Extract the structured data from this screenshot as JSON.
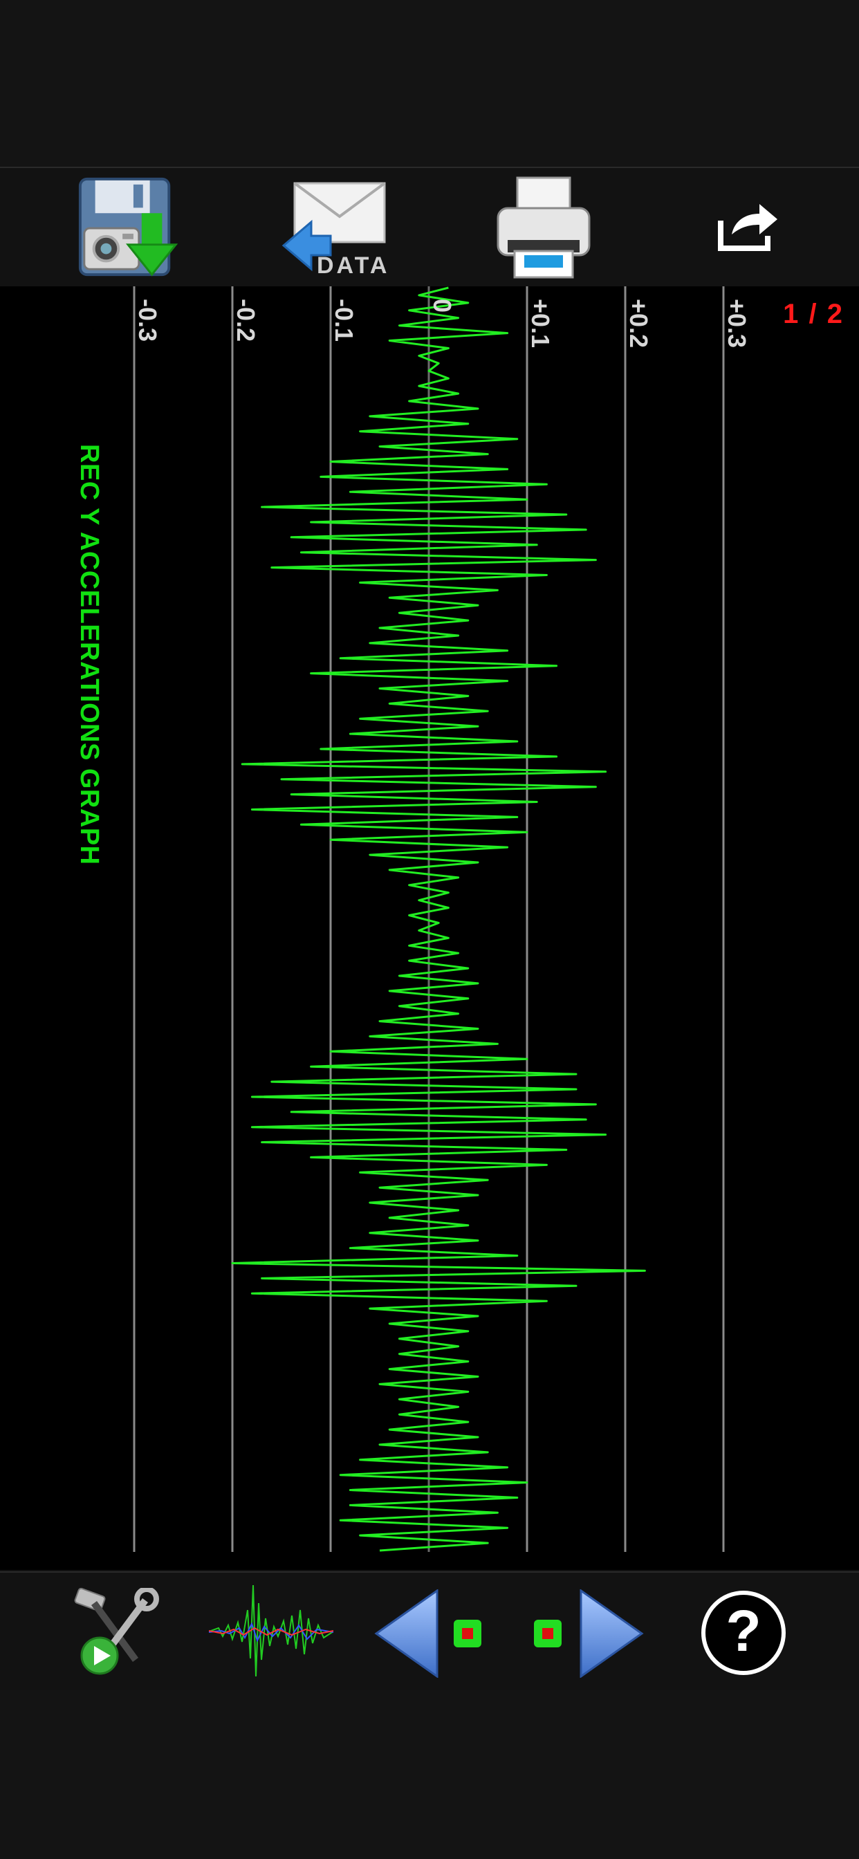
{
  "toolbar": {
    "save_icon": "save-screenshot-icon",
    "email_icon": "email-data-icon",
    "email_label": "DATA",
    "print_icon": "printer-icon",
    "share_icon": "share-icon"
  },
  "graph": {
    "title": "REC Y ACCELERATIONS GRAPH",
    "page_indicator": "1 / 2",
    "trace_color": "#22ee22"
  },
  "chart_data": {
    "type": "line",
    "orientation": "vertical-time",
    "title": "REC Y ACCELERATIONS GRAPH",
    "xlim": [
      -0.3,
      0.3
    ],
    "tick_labels": [
      "-0.3",
      "-0.2",
      "-0.1",
      "0",
      "+0.1",
      "+0.2",
      "+0.3"
    ],
    "ticks": [
      -0.3,
      -0.2,
      -0.1,
      0,
      0.1,
      0.2,
      0.3
    ],
    "grid": true,
    "series": [
      {
        "values": [
          0.02,
          -0.01,
          0.04,
          -0.02,
          0.03,
          -0.03,
          0.08,
          -0.04,
          0.02,
          -0.01,
          0.01,
          0.0,
          0.02,
          -0.01,
          0.03,
          -0.02,
          0.05,
          -0.06,
          0.04,
          -0.07,
          0.09,
          -0.05,
          0.06,
          -0.1,
          0.08,
          -0.11,
          0.12,
          -0.08,
          0.1,
          -0.17,
          0.14,
          -0.12,
          0.16,
          -0.14,
          0.11,
          -0.13,
          0.17,
          -0.16,
          0.12,
          -0.07,
          0.07,
          -0.04,
          0.05,
          -0.03,
          0.04,
          -0.05,
          0.03,
          -0.06,
          0.08,
          -0.09,
          0.13,
          -0.12,
          0.08,
          -0.05,
          0.04,
          -0.04,
          0.06,
          -0.07,
          0.05,
          -0.08,
          0.09,
          -0.11,
          0.13,
          -0.19,
          0.18,
          -0.15,
          0.17,
          -0.14,
          0.11,
          -0.18,
          0.09,
          -0.13,
          0.1,
          -0.1,
          0.08,
          -0.06,
          0.05,
          -0.04,
          0.03,
          -0.02,
          0.02,
          -0.01,
          0.02,
          -0.02,
          0.01,
          -0.01,
          0.02,
          -0.02,
          0.03,
          -0.02,
          0.04,
          -0.03,
          0.05,
          -0.04,
          0.04,
          -0.03,
          0.03,
          -0.05,
          0.05,
          -0.06,
          0.07,
          -0.1,
          0.1,
          -0.12,
          0.15,
          -0.16,
          0.15,
          -0.18,
          0.17,
          -0.14,
          0.16,
          -0.18,
          0.18,
          -0.17,
          0.14,
          -0.12,
          0.12,
          -0.07,
          0.06,
          -0.05,
          0.05,
          -0.06,
          0.03,
          -0.04,
          0.04,
          -0.06,
          0.05,
          -0.08,
          0.09,
          -0.2,
          0.22,
          -0.17,
          0.15,
          -0.18,
          0.12,
          -0.06,
          0.05,
          -0.04,
          0.04,
          -0.03,
          0.03,
          -0.03,
          0.04,
          -0.04,
          0.05,
          -0.05,
          0.04,
          -0.03,
          0.03,
          -0.03,
          0.04,
          -0.04,
          0.05,
          -0.05,
          0.06,
          -0.07,
          0.08,
          -0.09,
          0.1,
          -0.08,
          0.09,
          -0.08,
          0.07,
          -0.09,
          0.08,
          -0.07,
          0.06,
          -0.05
        ]
      }
    ]
  },
  "bottombar": {
    "settings_icon": "tools-settings-icon",
    "waveform_icon": "waveform-view-icon",
    "prev_icon": "previous-arrow-icon",
    "next_icon": "next-arrow-icon",
    "help_icon": "help-icon",
    "help_label": "?"
  }
}
